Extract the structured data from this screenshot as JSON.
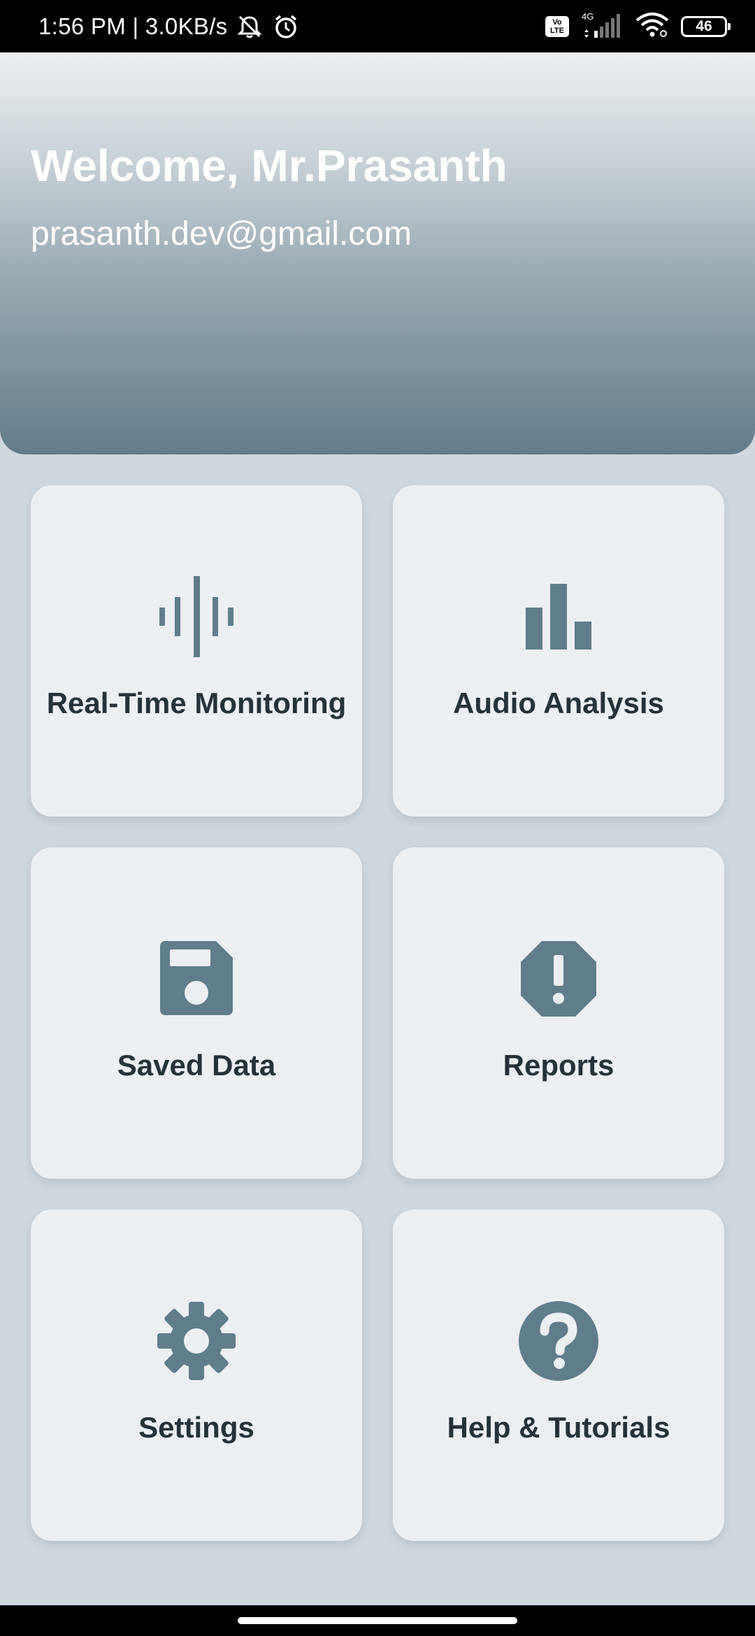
{
  "status_bar": {
    "time_speed": "1:56 PM | 3.0KB/s",
    "volte_top": "Vo",
    "volte_bottom": "LTE",
    "network_type": "4G",
    "battery": "46",
    "icons": [
      "mute-icon",
      "alarm-icon",
      "volte-icon",
      "signal-icon",
      "wifi-icon",
      "battery-icon"
    ]
  },
  "header": {
    "welcome": "Welcome, Mr.Prasanth",
    "email": "prasanth.dev@gmail.com"
  },
  "cards": [
    {
      "label": "Real-Time Monitoring",
      "icon": "waveform-icon"
    },
    {
      "label": "Audio Analysis",
      "icon": "bar-chart-icon"
    },
    {
      "label": "Saved Data",
      "icon": "save-icon"
    },
    {
      "label": "Reports",
      "icon": "alert-octagon-icon"
    },
    {
      "label": "Settings",
      "icon": "gear-icon"
    },
    {
      "label": "Help & Tutorials",
      "icon": "help-icon"
    }
  ],
  "colors": {
    "icon": "#607d8b",
    "card_bg": "#eceff2",
    "page_bg": "#cfd8df",
    "label": "#263238",
    "header_top": "#eceff1",
    "header_bottom": "#627d8b"
  }
}
